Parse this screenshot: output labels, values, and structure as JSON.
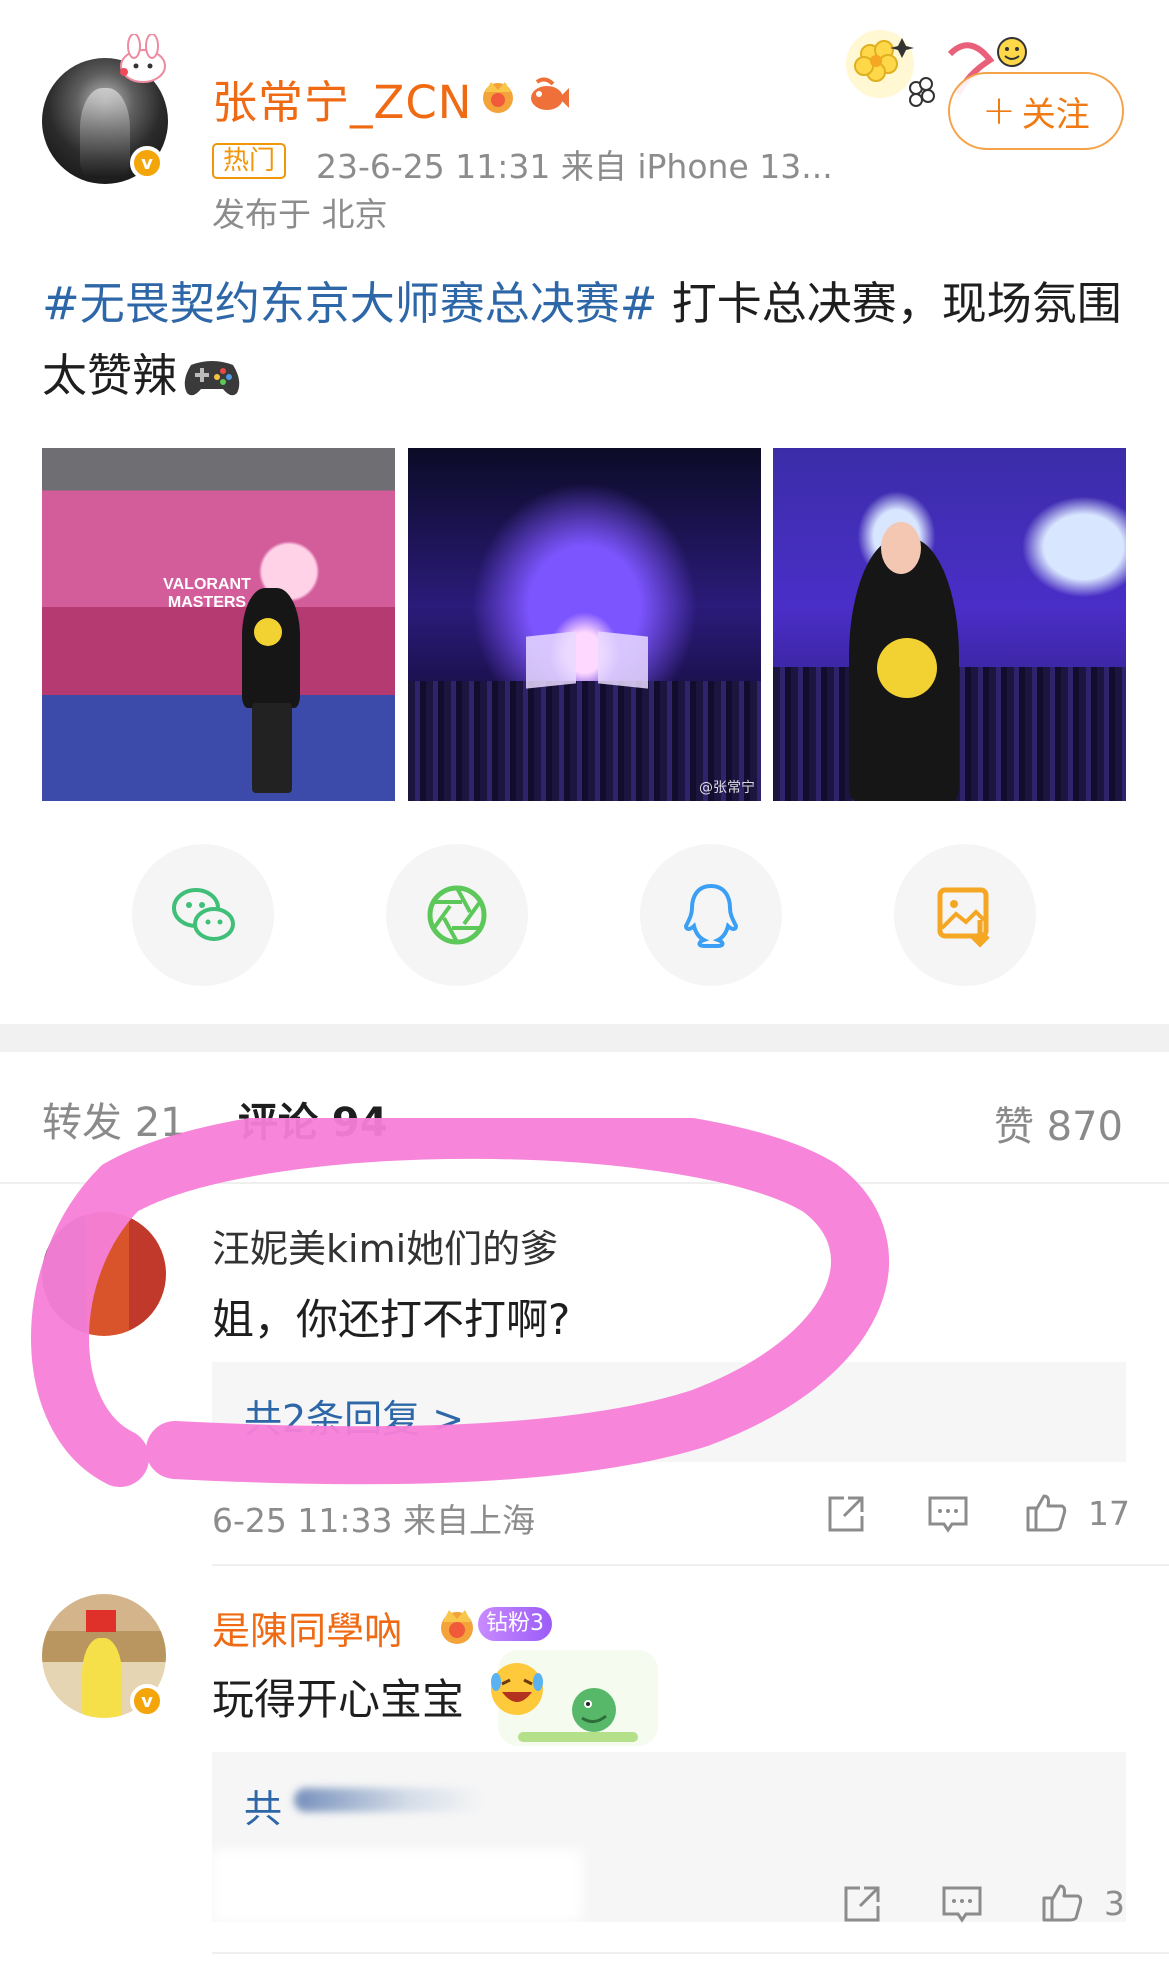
{
  "post": {
    "username": "张常宁_ZCN",
    "hot_tag": "热门",
    "meta": "23-6-25 11:31  来自 iPhone 13...",
    "published_in": "发布于 北京",
    "follow_label": "关注",
    "topic": "#无畏契约东京大师赛总决赛#",
    "body": " 打卡总决赛，现场氛围太赞辣",
    "icons": [
      "verified-icon",
      "crown-badge-icon",
      "fish-badge-icon",
      "gamepad-emoji-icon"
    ]
  },
  "photos": [
    {
      "poster_text": "VALORANT MASTERS"
    },
    {
      "watermark": "@张常宁"
    },
    {}
  ],
  "share": [
    {
      "name": "wechat",
      "icon": "wechat-icon",
      "color": "#3fbf77"
    },
    {
      "name": "moments",
      "icon": "moments-aperture-icon",
      "color": "#5cc85a"
    },
    {
      "name": "qq",
      "icon": "qq-icon",
      "color": "#3a9ff5"
    },
    {
      "name": "save-image",
      "icon": "save-image-icon",
      "color": "#f5a623"
    }
  ],
  "tabs": {
    "repost": "转发 21",
    "comment": "评论 94",
    "like": "赞 870"
  },
  "comments": [
    {
      "name": "汪妮美kimi她们的爹",
      "text": "姐，你还打不打啊?",
      "replies": "共2条回复 >",
      "meta": "6-25 11:33  来自上海",
      "likes": "17"
    },
    {
      "name": "是陳同學吶",
      "badge": "钻粉3",
      "text": "玩得开心宝宝",
      "replies": "共",
      "likes": "3"
    }
  ],
  "colors": {
    "orange_name": "#f06a13",
    "link_blue": "#2e67a8",
    "highlight_pink": "#f77fd8"
  }
}
